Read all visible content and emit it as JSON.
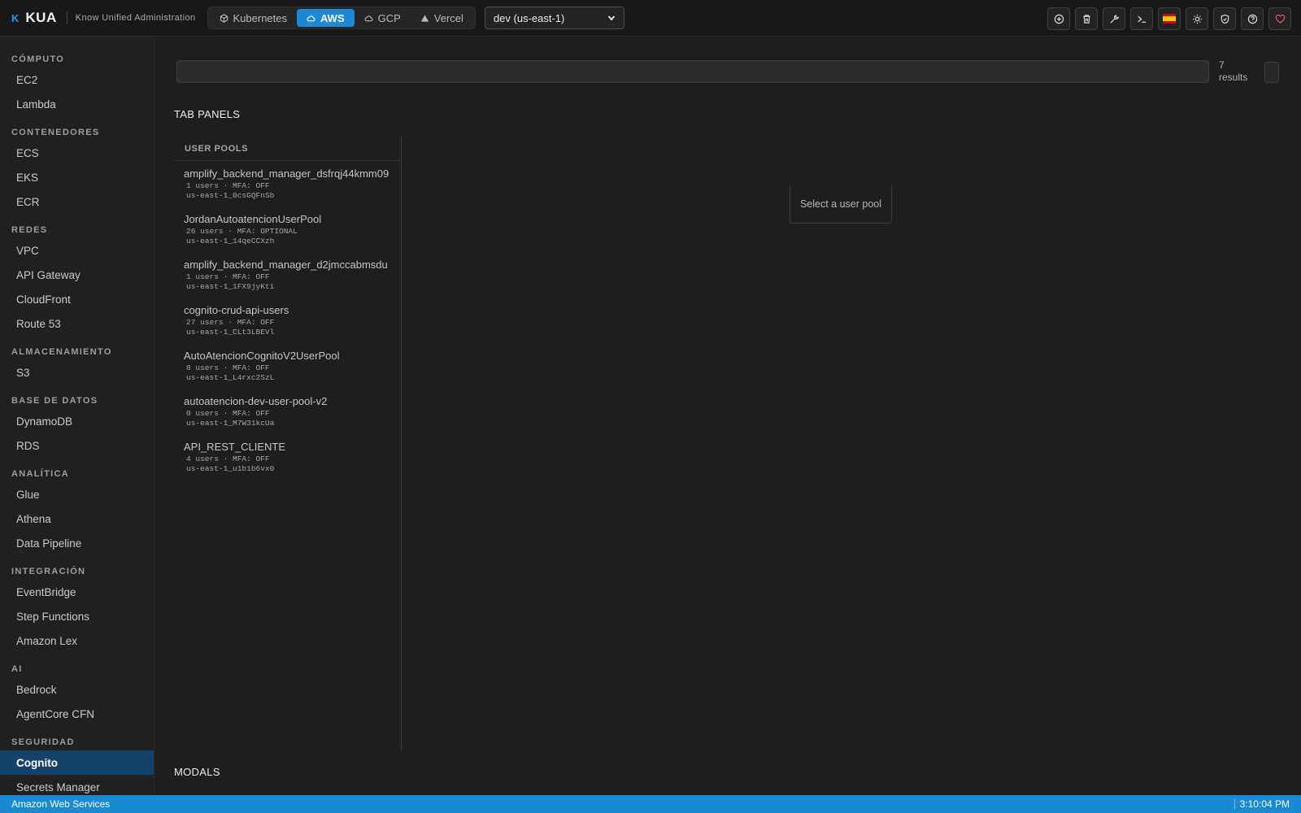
{
  "brand": {
    "mark": "K",
    "name": "KUA",
    "subtitle": "Know Unified Administration"
  },
  "providers": [
    {
      "label": "Kubernetes",
      "icon": "cube-icon",
      "active": false
    },
    {
      "label": "AWS",
      "icon": "cloud-icon",
      "active": true
    },
    {
      "label": "GCP",
      "icon": "cloud-icon",
      "active": false
    },
    {
      "label": "Vercel",
      "icon": "triangle-icon",
      "active": false
    }
  ],
  "environment": {
    "selected": "dev (us-east-1)"
  },
  "toolbar_icons": [
    "plus-circle-icon",
    "trash-icon",
    "wrench-icon",
    "terminal-icon",
    "spain-flag-icon",
    "sun-icon",
    "shield-icon",
    "help-icon",
    "heart-icon"
  ],
  "sidebar": {
    "sections": [
      {
        "title": "CÓMPUTO",
        "items": [
          "EC2",
          "Lambda"
        ]
      },
      {
        "title": "CONTENEDORES",
        "items": [
          "ECS",
          "EKS",
          "ECR"
        ]
      },
      {
        "title": "REDES",
        "items": [
          "VPC",
          "API Gateway",
          "CloudFront",
          "Route 53"
        ]
      },
      {
        "title": "ALMACENAMIENTO",
        "items": [
          "S3"
        ]
      },
      {
        "title": "BASE DE DATOS",
        "items": [
          "DynamoDB",
          "RDS"
        ]
      },
      {
        "title": "ANALÍTICA",
        "items": [
          "Glue",
          "Athena",
          "Data Pipeline"
        ]
      },
      {
        "title": "INTEGRACIÓN",
        "items": [
          "EventBridge",
          "Step Functions",
          "Amazon Lex"
        ]
      },
      {
        "title": "AI",
        "items": [
          "Bedrock",
          "AgentCore CFN"
        ]
      },
      {
        "title": "SEGURIDAD",
        "items": [
          "Cognito",
          "Secrets Manager"
        ]
      }
    ],
    "active_item": "Cognito"
  },
  "search": {
    "value": "",
    "results_text": "7 results"
  },
  "headings": {
    "tab_panels": "TAB PANELS",
    "modals": "MODALS"
  },
  "user_pools": {
    "header": "USER POOLS",
    "items": [
      {
        "name": "amplify_backend_manager_dsfrqj44kmm09",
        "meta": "1 users · MFA: OFF",
        "id": "us-east-1_0csGQFnSb"
      },
      {
        "name": "JordanAutoatencionUserPool",
        "meta": "26 users · MFA: OPTIONAL",
        "id": "us-east-1_14qeCCXzh"
      },
      {
        "name": "amplify_backend_manager_d2jmccabmsdu",
        "meta": "1 users · MFA: OFF",
        "id": "us-east-1_1FX9jyKti"
      },
      {
        "name": "cognito-crud-api-users",
        "meta": "27 users · MFA: OFF",
        "id": "us-east-1_CLt3LBEVl"
      },
      {
        "name": "AutoAtencionCognitoV2UserPool",
        "meta": "8 users · MFA: OFF",
        "id": "us-east-1_L4rxc2SzL"
      },
      {
        "name": "autoatencion-dev-user-pool-v2",
        "meta": "0 users · MFA: OFF",
        "id": "us-east-1_M7W31kcUa"
      },
      {
        "name": "API_REST_CLIENTE",
        "meta": "4 users · MFA: OFF",
        "id": "us-east-1_u1b1b6vx0"
      }
    ],
    "empty_message": "Select a user pool"
  },
  "statusbar": {
    "provider": "Amazon Web Services",
    "time": "3:10:04 PM"
  },
  "colors": {
    "accent": "#1a8ad4",
    "active_sidebar": "#14436a",
    "favorite": "#e05561"
  }
}
